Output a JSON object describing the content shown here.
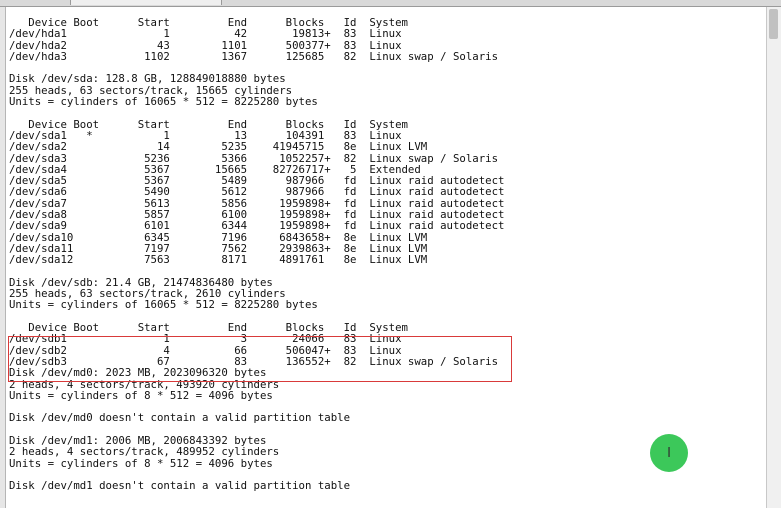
{
  "terminal": {
    "lines": [
      "   Device Boot      Start         End      Blocks   Id  System",
      "/dev/hda1               1          42       19813+  83  Linux",
      "/dev/hda2              43        1101      500377+  83  Linux",
      "/dev/hda3            1102        1367      125685   82  Linux swap / Solaris",
      "",
      "Disk /dev/sda: 128.8 GB, 128849018880 bytes",
      "255 heads, 63 sectors/track, 15665 cylinders",
      "Units = cylinders of 16065 * 512 = 8225280 bytes",
      "",
      "   Device Boot      Start         End      Blocks   Id  System",
      "/dev/sda1   *           1          13      104391   83  Linux",
      "/dev/sda2              14        5235    41945715   8e  Linux LVM",
      "/dev/sda3            5236        5366     1052257+  82  Linux swap / Solaris",
      "/dev/sda4            5367       15665    82726717+   5  Extended",
      "/dev/sda5            5367        5489      987966   fd  Linux raid autodetect",
      "/dev/sda6            5490        5612      987966   fd  Linux raid autodetect",
      "/dev/sda7            5613        5856     1959898+  fd  Linux raid autodetect",
      "/dev/sda8            5857        6100     1959898+  fd  Linux raid autodetect",
      "/dev/sda9            6101        6344     1959898+  fd  Linux raid autodetect",
      "/dev/sda10           6345        7196     6843658+  8e  Linux LVM",
      "/dev/sda11           7197        7562     2939863+  8e  Linux LVM",
      "/dev/sda12           7563        8171     4891761   8e  Linux LVM",
      "",
      "Disk /dev/sdb: 21.4 GB, 21474836480 bytes",
      "255 heads, 63 sectors/track, 2610 cylinders",
      "Units = cylinders of 16065 * 512 = 8225280 bytes",
      "",
      "   Device Boot      Start         End      Blocks   Id  System",
      "/dev/sdb1               1           3       24066   83  Linux",
      "/dev/sdb2               4          66      506047+  83  Linux",
      "/dev/sdb3              67          83      136552+  82  Linux swap / Solaris",
      "Disk /dev/md0: 2023 MB, 2023096320 bytes",
      "2 heads, 4 sectors/track, 493920 cylinders",
      "Units = cylinders of 8 * 512 = 4096 bytes",
      "",
      "Disk /dev/md0 doesn't contain a valid partition table",
      "",
      "Disk /dev/md1: 2006 MB, 2006843392 bytes",
      "2 heads, 4 sectors/track, 489952 cylinders",
      "Units = cylinders of 8 * 512 = 4096 bytes",
      "",
      "Disk /dev/md1 doesn't contain a valid partition table"
    ]
  },
  "cursor_indicator": {
    "glyph": "I",
    "color": "#3cc85a"
  },
  "highlight_box": {
    "color": "#d93a3a"
  }
}
